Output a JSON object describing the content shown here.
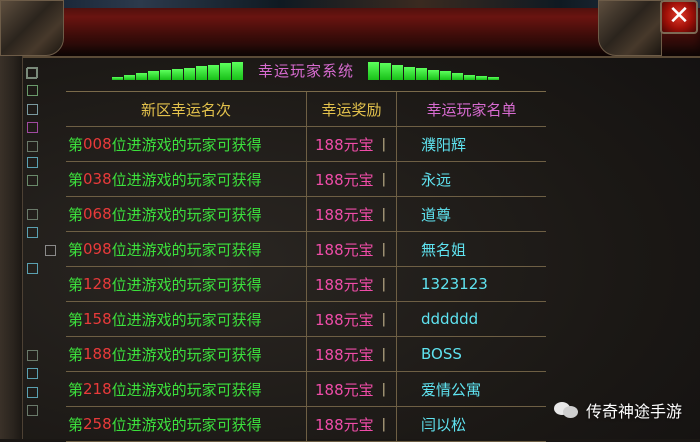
{
  "window": {
    "close_glyph": "✕"
  },
  "heading": {
    "title": "幸运玩家系统"
  },
  "table": {
    "headers": [
      "新区幸运名次",
      "幸运奖励",
      "幸运玩家名单"
    ],
    "rows": [
      {
        "prefix": "第",
        "rank": "008",
        "suffix": "位进游戏的玩家可获得",
        "reward": "188元宝",
        "player": "濮阳辉"
      },
      {
        "prefix": "第",
        "rank": "038",
        "suffix": "位进游戏的玩家可获得",
        "reward": "188元宝",
        "player": "永远"
      },
      {
        "prefix": "第",
        "rank": "068",
        "suffix": "位进游戏的玩家可获得",
        "reward": "188元宝",
        "player": "道尊"
      },
      {
        "prefix": "第",
        "rank": "098",
        "suffix": "位进游戏的玩家可获得",
        "reward": "188元宝",
        "player": "無名姐"
      },
      {
        "prefix": "第",
        "rank": "128",
        "suffix": "位进游戏的玩家可获得",
        "reward": "188元宝",
        "player": "1323123"
      },
      {
        "prefix": "第",
        "rank": "158",
        "suffix": "位进游戏的玩家可获得",
        "reward": "188元宝",
        "player": "dddddd"
      },
      {
        "prefix": "第",
        "rank": "188",
        "suffix": "位进游戏的玩家可获得",
        "reward": "188元宝",
        "player": "BOSS"
      },
      {
        "prefix": "第",
        "rank": "218",
        "suffix": "位进游戏的玩家可获得",
        "reward": "188元宝",
        "player": "爱情公寓"
      },
      {
        "prefix": "第",
        "rank": "258",
        "suffix": "位进游戏的玩家可获得",
        "reward": "188元宝",
        "player": "闫以松"
      }
    ]
  },
  "watermark": {
    "text": "传奇神途手游"
  },
  "colors": {
    "header_gold": "#e3c24c",
    "title_magenta": "#d76bd0",
    "text_green": "#3ce03c",
    "rank_red": "#e83a3a",
    "reward_pink": "#f04ca8",
    "player_cyan": "#5fe3f0"
  }
}
